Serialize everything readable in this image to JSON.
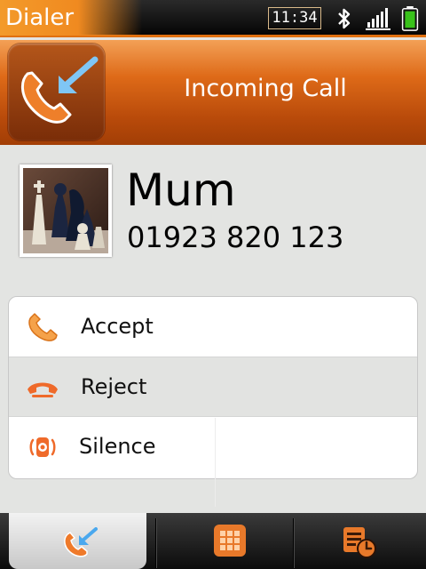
{
  "statusbar": {
    "app_title": "Dialer",
    "clock": "11:34",
    "icons": [
      "bluetooth-icon",
      "signal-icon",
      "battery-icon"
    ]
  },
  "header": {
    "title": "Incoming Call",
    "icon": "incoming-call-icon"
  },
  "contact": {
    "name": "Mum",
    "number": "01923 820 123",
    "avatar": "chess-pieces-photo"
  },
  "options": [
    {
      "label": "Accept",
      "icon": "phone-accept-icon"
    },
    {
      "label": "Reject",
      "icon": "phone-reject-icon"
    },
    {
      "label": "Silence",
      "icon": "silence-ringer-icon"
    }
  ],
  "bottom_tabs": [
    {
      "icon": "incoming-call-icon",
      "active": true
    },
    {
      "icon": "keypad-icon",
      "active": false
    },
    {
      "icon": "call-log-icon",
      "active": false
    }
  ],
  "colors": {
    "accent": "#f08a20",
    "header_dark": "#a23e06",
    "background": "#e3e4e2"
  }
}
